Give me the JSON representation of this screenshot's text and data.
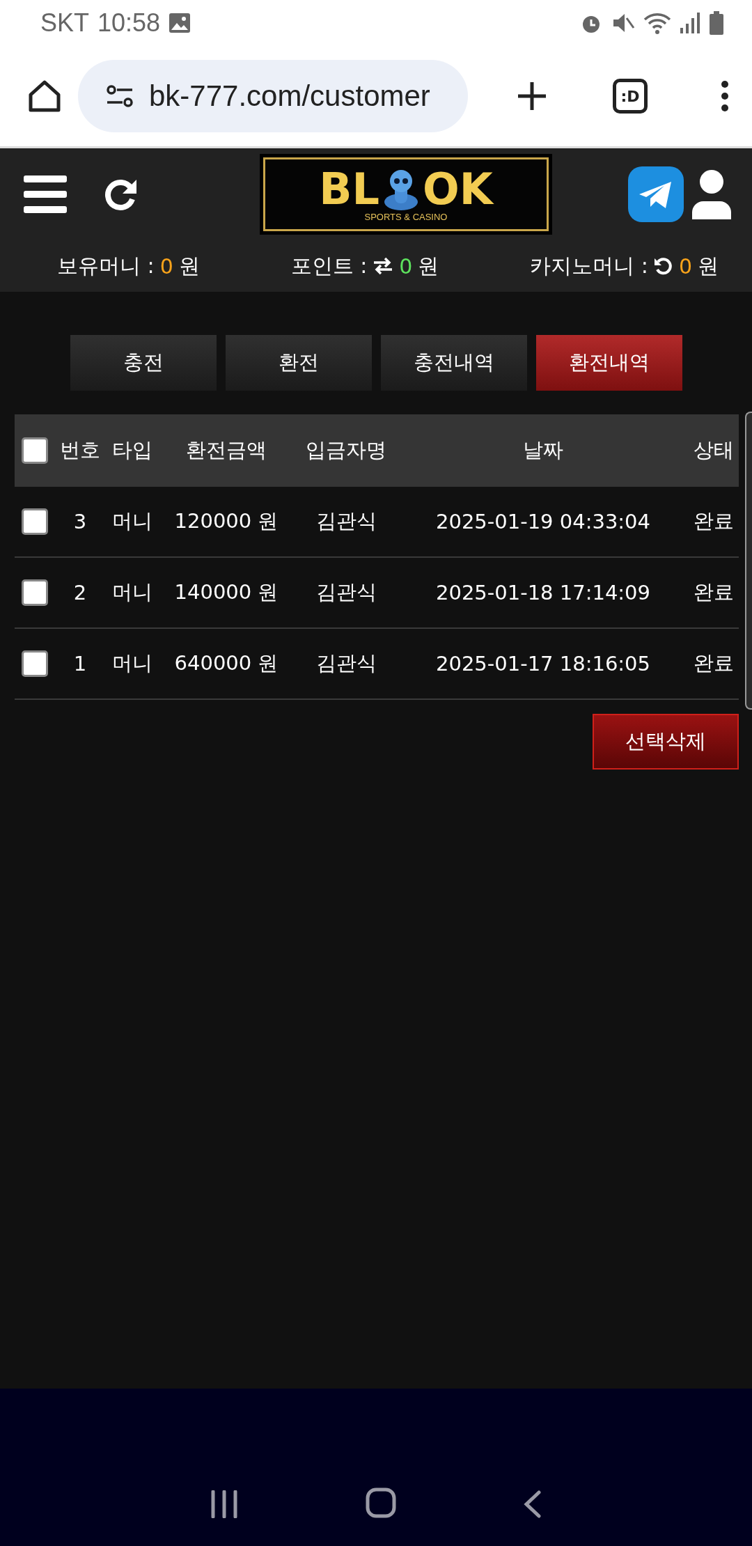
{
  "status_bar": {
    "carrier": "SKT",
    "time": "10:58"
  },
  "browser": {
    "url": "bk-777.com/customer",
    "tab_switcher": ":D"
  },
  "header": {
    "logo": {
      "left": "BL",
      "right": "OK",
      "tagline": "SPORTS & CASINO"
    }
  },
  "balances": [
    {
      "kind": "money",
      "label": "보유머니 :",
      "value": "0",
      "unit": "원"
    },
    {
      "kind": "point",
      "label": "포인트 :",
      "value": "0",
      "unit": "원"
    },
    {
      "kind": "casino",
      "label": "카지노머니 :",
      "value": "0",
      "unit": "원"
    }
  ],
  "tabs": [
    {
      "label": "충전",
      "selected": false
    },
    {
      "label": "환전",
      "selected": false
    },
    {
      "label": "충전내역",
      "selected": false
    },
    {
      "label": "환전내역",
      "selected": true
    }
  ],
  "table": {
    "select_all": {
      "checked": false
    },
    "columns": [
      "번호",
      "타입",
      "환전금액",
      "입금자명",
      "날짜",
      "상태"
    ],
    "rows": [
      {
        "checked": false,
        "cells": [
          "3",
          "머니",
          "120000 원",
          "김관식",
          "2025-01-19 04:33:04",
          "완료"
        ]
      },
      {
        "checked": false,
        "cells": [
          "2",
          "머니",
          "140000 원",
          "김관식",
          "2025-01-18 17:14:09",
          "완료"
        ]
      },
      {
        "checked": false,
        "cells": [
          "1",
          "머니",
          "640000 원",
          "김관식",
          "2025-01-17 18:16:05",
          "완료"
        ]
      }
    ]
  },
  "delete_button": "선택삭제"
}
